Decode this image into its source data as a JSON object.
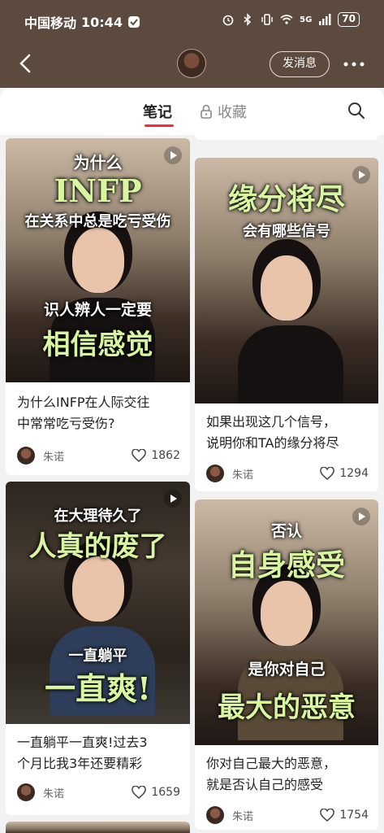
{
  "status_bar": {
    "carrier": "中国移动",
    "time": "10:44",
    "network": "5G",
    "battery": "70"
  },
  "header": {
    "message_button": "发消息"
  },
  "tabs": {
    "notes": "笔记",
    "favorites": "收藏"
  },
  "posts": [
    {
      "overlay": [
        "为什么",
        "INFP",
        "在关系中总是吃亏受伤",
        "识人辨人一定要",
        "相信感觉"
      ],
      "caption_lines": [
        "为什么INFP在人际交往",
        "中常常吃亏受伤?"
      ],
      "author": "朱诺",
      "likes": "1862"
    },
    {
      "overlay": [
        "缘分将尽",
        "会有哪些信号"
      ],
      "caption_lines": [
        "如果出现这几个信号，",
        "说明你和TA的缘分将尽"
      ],
      "author": "朱诺",
      "likes": "1294"
    },
    {
      "overlay": [
        "在大理待久了",
        "人真的废了",
        "一直躺平",
        "一直爽!"
      ],
      "caption_lines": [
        "一直躺平一直爽!过去3",
        "个月比我3年还要精彩"
      ],
      "author": "朱诺",
      "likes": "1659"
    },
    {
      "overlay": [
        "否认",
        "自身感受",
        "是你对自己",
        "最大的恶意"
      ],
      "caption_lines": [
        "你对自己最大的恶意，",
        "就是否认自己的感受"
      ],
      "author": "朱诺",
      "likes": "1754"
    }
  ]
}
